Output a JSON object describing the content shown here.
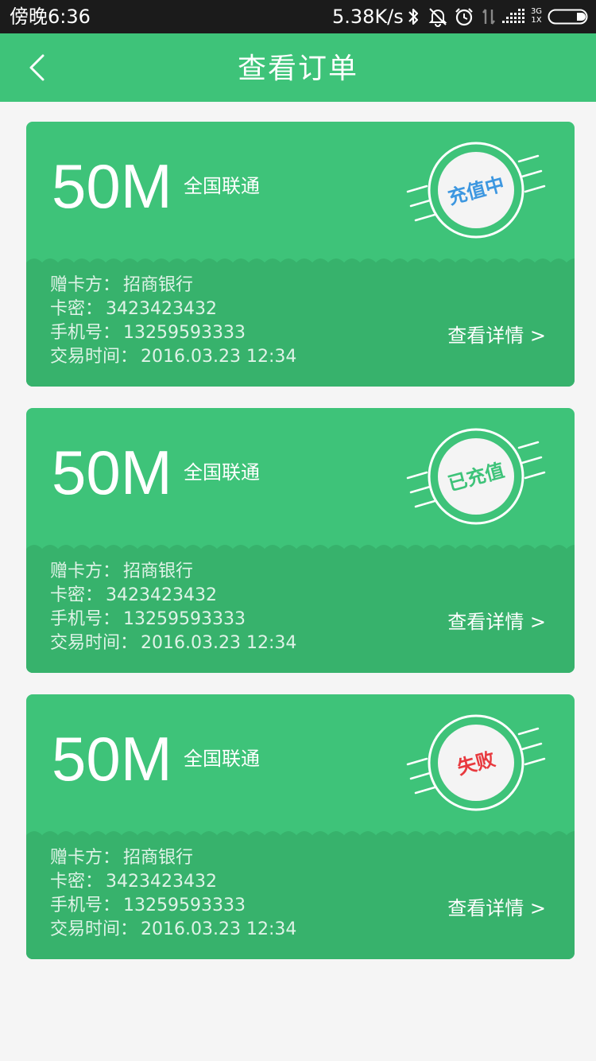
{
  "status_bar": {
    "time": "傍晚6:36",
    "speed": "5.38K/s",
    "network_top": "3G",
    "network_bottom": "1X",
    "icons": [
      "bluetooth-icon",
      "alarm-off-icon",
      "alarm-clock-icon",
      "data-transfer-icon",
      "signal-icon",
      "battery-icon"
    ]
  },
  "header": {
    "title": "查看订单",
    "back_icon": "chevron-left-icon"
  },
  "labels": {
    "giver": "赠卡方：",
    "card_pin": "卡密：",
    "phone": "手机号：",
    "time": "交易时间：",
    "details": "查看详情 >"
  },
  "orders": [
    {
      "amount": "50M",
      "carrier": "全国联通",
      "status": "充值中",
      "status_color": "#3d97e0",
      "giver": "招商银行",
      "card_pin": "3423423432",
      "phone": "13259593333",
      "time": "2016.03.23 12:34"
    },
    {
      "amount": "50M",
      "carrier": "全国联通",
      "status": "已充值",
      "status_color": "#3ec379",
      "giver": "招商银行",
      "card_pin": "3423423432",
      "phone": "13259593333",
      "time": "2016.03.23 12:34"
    },
    {
      "amount": "50M",
      "carrier": "全国联通",
      "status": "失败",
      "status_color": "#e8393e",
      "giver": "招商银行",
      "card_pin": "3423423432",
      "phone": "13259593333",
      "time": "2016.03.23 12:34"
    }
  ],
  "colors": {
    "primary": "#3ec379",
    "card_bottom": "#37b26c",
    "background": "#f5f5f5"
  }
}
